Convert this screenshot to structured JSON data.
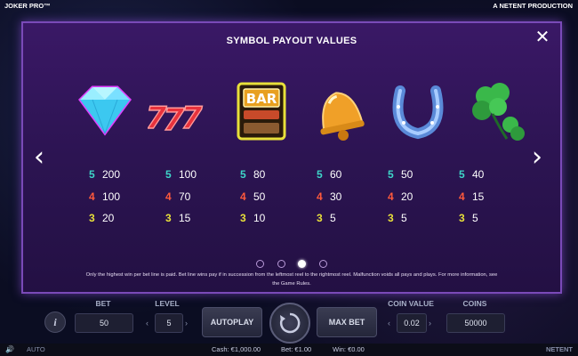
{
  "header": {
    "game_title": "JOKER PRO™",
    "studio": "A NETENT PRODUCTION"
  },
  "paytable": {
    "title": "SYMBOL PAYOUT VALUES",
    "close_icon": "close-icon",
    "prev_icon": "chevron-left-icon",
    "next_icon": "chevron-right-icon",
    "symbols": [
      {
        "icon": "diamond-icon",
        "payouts": [
          {
            "count": "5",
            "value": "200"
          },
          {
            "count": "4",
            "value": "100"
          },
          {
            "count": "3",
            "value": "20"
          }
        ]
      },
      {
        "icon": "seven-icon",
        "payouts": [
          {
            "count": "5",
            "value": "100"
          },
          {
            "count": "4",
            "value": "70"
          },
          {
            "count": "3",
            "value": "15"
          }
        ]
      },
      {
        "icon": "bar-icon",
        "label": "BAR",
        "payouts": [
          {
            "count": "5",
            "value": "80"
          },
          {
            "count": "4",
            "value": "50"
          },
          {
            "count": "3",
            "value": "10"
          }
        ]
      },
      {
        "icon": "bell-icon",
        "payouts": [
          {
            "count": "5",
            "value": "60"
          },
          {
            "count": "4",
            "value": "30"
          },
          {
            "count": "3",
            "value": "5"
          }
        ]
      },
      {
        "icon": "horseshoe-icon",
        "payouts": [
          {
            "count": "5",
            "value": "50"
          },
          {
            "count": "4",
            "value": "20"
          },
          {
            "count": "3",
            "value": "5"
          }
        ]
      },
      {
        "icon": "clover-icon",
        "payouts": [
          {
            "count": "5",
            "value": "40"
          },
          {
            "count": "4",
            "value": "15"
          },
          {
            "count": "3",
            "value": "5"
          }
        ]
      }
    ],
    "count_colors": {
      "5": "#3ed6c8",
      "4": "#ff5a3c",
      "3": "#e8e03a"
    },
    "pager": {
      "total": 4,
      "active": 3
    },
    "rules_line1": "Only the highest win per bet line is paid. Bet line wins pay if in succession from the leftmost reel to the rightmost reel. Malfunction voids all pays and plays. For more information, see",
    "rules_line2": "the Game Rules."
  },
  "controls": {
    "bet_label": "BET",
    "bet_value": "50",
    "level_label": "LEVEL",
    "level_value": "5",
    "autoplay_label": "AUTOPLAY",
    "maxbet_label": "MAX BET",
    "coin_value_label": "COIN VALUE",
    "coin_value": "0.02",
    "coins_label": "COINS",
    "coins_value": "50000"
  },
  "status": {
    "auto_label": "AUTO",
    "cash": "Cash: €1,000.00",
    "bet": "Bet: €1.00",
    "win": "Win: €0.00",
    "brand": "NETENT"
  }
}
